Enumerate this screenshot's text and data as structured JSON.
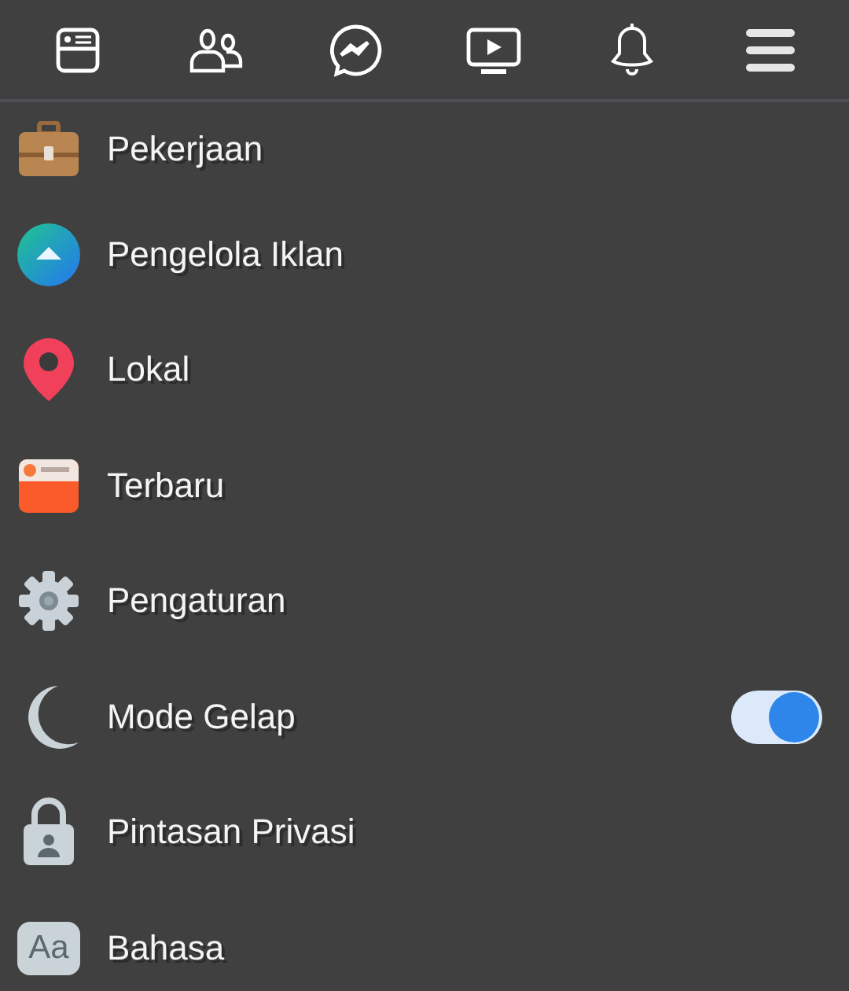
{
  "nav": [
    {
      "kind": "news"
    },
    {
      "kind": "friends"
    },
    {
      "kind": "messenger"
    },
    {
      "kind": "watch"
    },
    {
      "kind": "bell"
    },
    {
      "kind": "menu"
    }
  ],
  "items": [
    {
      "kind": "briefcase",
      "label": "Pekerjaan"
    },
    {
      "kind": "ads",
      "label": "Pengelola Iklan"
    },
    {
      "kind": "pin",
      "label": "Lokal"
    },
    {
      "kind": "feed",
      "label": "Terbaru"
    },
    {
      "kind": "gear",
      "label": "Pengaturan"
    },
    {
      "kind": "moon",
      "label": "Mode Gelap",
      "on": true
    },
    {
      "kind": "lock",
      "label": "Pintasan Privasi"
    },
    {
      "kind": "language",
      "label": "Bahasa",
      "icon_text": "Aa"
    }
  ]
}
